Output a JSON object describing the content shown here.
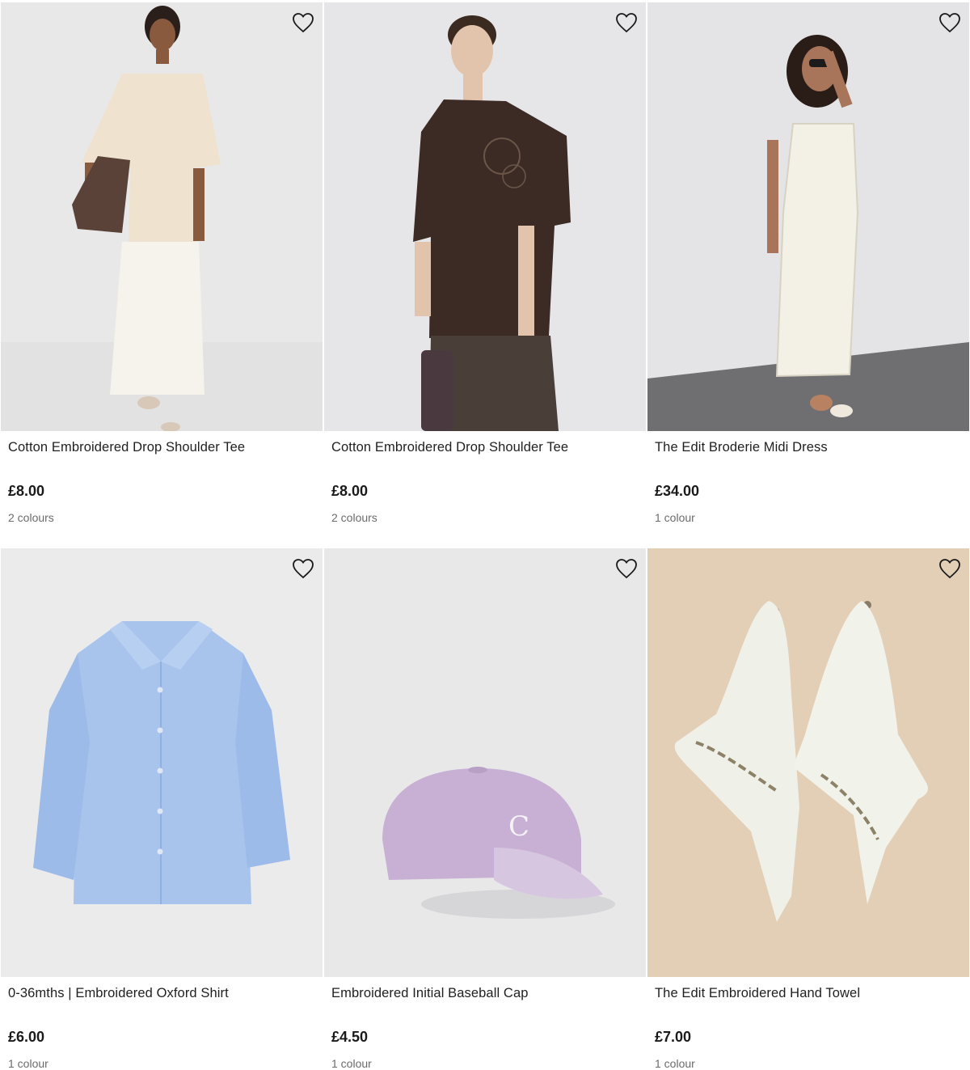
{
  "products": [
    {
      "title": "Cotton Embroidered Drop Shoulder Tee",
      "price": "£8.00",
      "colours": "2 colours",
      "image": "model-cream-tee-white-skirt",
      "wishlist_icon": "heart-outline-icon"
    },
    {
      "title": "Cotton Embroidered Drop Shoulder Tee",
      "price": "£8.00",
      "colours": "2 colours",
      "image": "model-brown-tee-brown-skirt",
      "wishlist_icon": "heart-outline-icon"
    },
    {
      "title": "The Edit Broderie Midi Dress",
      "price": "£34.00",
      "colours": "1 colour",
      "image": "model-white-broderie-dress",
      "wishlist_icon": "heart-outline-icon"
    },
    {
      "title": "0-36mths | Embroidered Oxford Shirt",
      "price": "£6.00",
      "colours": "1 colour",
      "image": "blue-oxford-shirt",
      "wishlist_icon": "heart-outline-icon"
    },
    {
      "title": "Embroidered Initial Baseball Cap",
      "price": "£4.50",
      "colours": "1 colour",
      "image": "lilac-baseball-cap",
      "cap_initial": "C",
      "wishlist_icon": "heart-outline-icon"
    },
    {
      "title": "The Edit Embroidered Hand Towel",
      "price": "£7.00",
      "colours": "1 colour",
      "image": "white-hand-towels",
      "wishlist_icon": "heart-outline-icon"
    }
  ],
  "colors": {
    "background": "#ffffff",
    "image_bg_grey": "#e9e9ea",
    "towel_bg_beige": "#e6d4bd",
    "text": "#1a1a1a",
    "muted": "#6b6b6b"
  }
}
